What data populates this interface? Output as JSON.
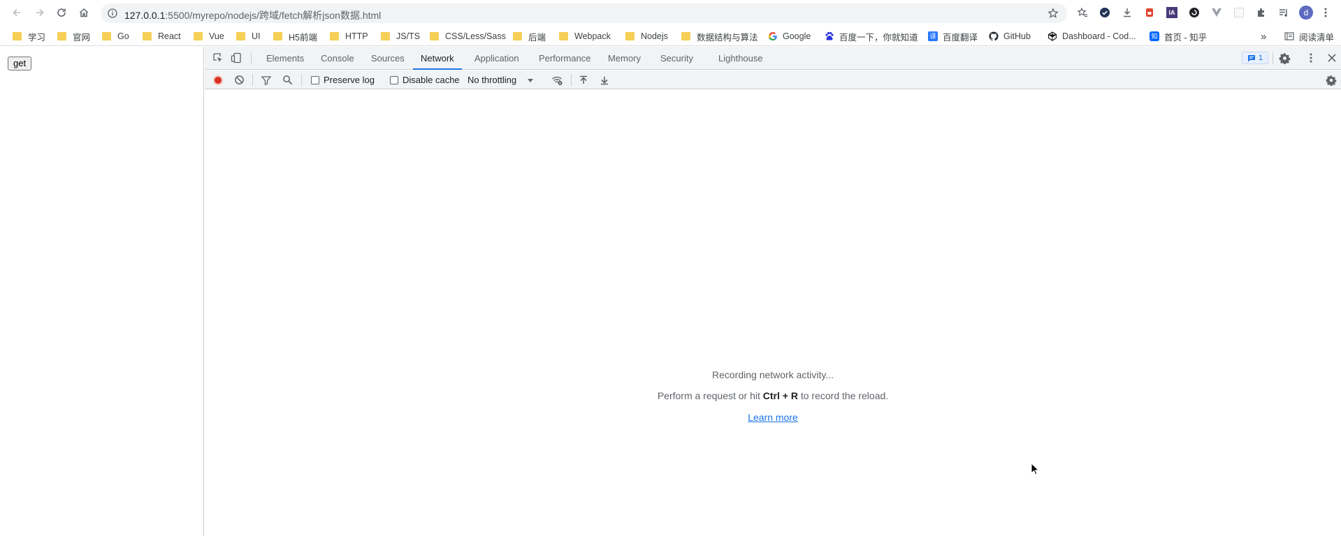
{
  "address_bar": {
    "url_host": "127.0.0.1",
    "url_path": ":5500/myrepo/nodejs/跨域/fetch解析json数据.html"
  },
  "bookmarks": [
    {
      "label": "学习",
      "type": "folder"
    },
    {
      "label": "官网",
      "type": "folder"
    },
    {
      "label": "Go",
      "type": "folder"
    },
    {
      "label": "React",
      "type": "folder"
    },
    {
      "label": "Vue",
      "type": "folder"
    },
    {
      "label": "UI",
      "type": "folder"
    },
    {
      "label": "H5前端",
      "type": "folder"
    },
    {
      "label": "HTTP",
      "type": "folder"
    },
    {
      "label": "JS/TS",
      "type": "folder"
    },
    {
      "label": "CSS/Less/Sass",
      "type": "folder"
    },
    {
      "label": "后端",
      "type": "folder"
    },
    {
      "label": "Webpack",
      "type": "folder"
    },
    {
      "label": "Nodejs",
      "type": "folder"
    },
    {
      "label": "数据结构与算法",
      "type": "folder"
    },
    {
      "label": "Google",
      "type": "google-icon"
    },
    {
      "label": "百度一下，你就知道",
      "type": "baidu-icon"
    },
    {
      "label": "百度翻译",
      "type": "translate-icon"
    },
    {
      "label": "GitHub",
      "type": "github-icon"
    },
    {
      "label": "Dashboard - Cod...",
      "type": "codepen-icon"
    },
    {
      "label": "首页 - 知乎",
      "type": "zhihu-icon"
    }
  ],
  "bookmarks_overflow": "»",
  "reading_list": "阅读清单",
  "profile_initial": "d",
  "page": {
    "get_button": "get"
  },
  "devtools": {
    "tabs": [
      "Elements",
      "Console",
      "Sources",
      "Network",
      "Application",
      "Performance",
      "Memory",
      "Security",
      "Lighthouse"
    ],
    "active_tab": "Network",
    "issues_count": "1",
    "toolbar": {
      "preserve_log": "Preserve log",
      "disable_cache": "Disable cache",
      "throttling": "No throttling"
    },
    "empty_state": {
      "line1": "Recording network activity...",
      "line2_prefix": "Perform a request or hit ",
      "line2_keys": "Ctrl + R",
      "line2_suffix": " to record the reload.",
      "link": "Learn more"
    }
  },
  "colors": {
    "accent": "#1a73e8",
    "record": "#d93025",
    "folder": "#f6cf57",
    "toolbar_bg": "#f1f3f4"
  }
}
